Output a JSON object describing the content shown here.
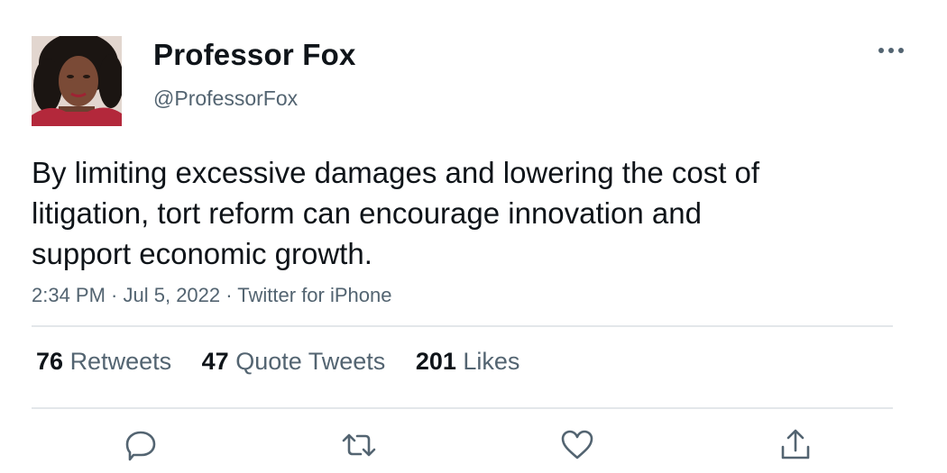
{
  "author": {
    "display_name": "Professor Fox",
    "handle": "@ProfessorFox",
    "avatar_icon": "profile-photo"
  },
  "tweet": {
    "text": "By limiting excessive damages and lowering the cost of\nlitigation, tort reform can encourage innovation and\nsupport economic growth.",
    "time": "2:34 PM",
    "date": "Jul 5, 2022",
    "source": "Twitter for iPhone",
    "separator": " · "
  },
  "stats": {
    "retweets": {
      "count": "76",
      "label": "Retweets"
    },
    "quote_tweets": {
      "count": "47",
      "label": "Quote Tweets"
    },
    "likes": {
      "count": "201",
      "label": "Likes"
    }
  },
  "actions": [
    "reply-icon",
    "retweet-icon",
    "like-icon",
    "share-icon"
  ],
  "colors": {
    "text_primary": "#0f1419",
    "text_secondary": "#536471",
    "divider": "#e3e7ea"
  }
}
